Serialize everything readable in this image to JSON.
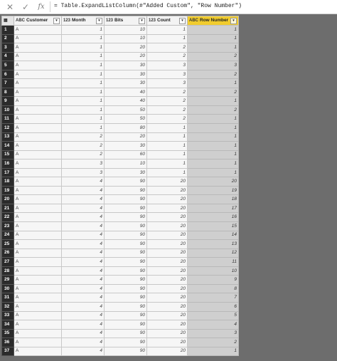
{
  "formula": {
    "text": "= Table.ExpandListColumn(#\"Added Custom\", \"Row Number\")",
    "cancel_icon": "close-icon",
    "commit_icon": "check-icon",
    "fx_label": "fx"
  },
  "columns": [
    {
      "label": "Customer",
      "type": "ABC"
    },
    {
      "label": "Month",
      "type": "123"
    },
    {
      "label": "Bits",
      "type": "123"
    },
    {
      "label": "Count",
      "type": "123"
    },
    {
      "label": "Row Number",
      "type": "ABC"
    }
  ],
  "rows": [
    [
      "1",
      "A",
      "1",
      "10",
      "1",
      "1"
    ],
    [
      "2",
      "A",
      "1",
      "10",
      "1",
      "1"
    ],
    [
      "3",
      "A",
      "1",
      "20",
      "2",
      "1"
    ],
    [
      "4",
      "A",
      "1",
      "20",
      "2",
      "2"
    ],
    [
      "5",
      "A",
      "1",
      "30",
      "3",
      "3"
    ],
    [
      "6",
      "A",
      "1",
      "30",
      "3",
      "2"
    ],
    [
      "7",
      "A",
      "1",
      "30",
      "3",
      "1"
    ],
    [
      "8",
      "A",
      "1",
      "40",
      "2",
      "2"
    ],
    [
      "9",
      "A",
      "1",
      "40",
      "2",
      "1"
    ],
    [
      "10",
      "A",
      "1",
      "50",
      "2",
      "2"
    ],
    [
      "11",
      "A",
      "1",
      "50",
      "2",
      "1"
    ],
    [
      "12",
      "A",
      "1",
      "80",
      "1",
      "1"
    ],
    [
      "13",
      "A",
      "2",
      "20",
      "1",
      "1"
    ],
    [
      "14",
      "A",
      "2",
      "30",
      "1",
      "1"
    ],
    [
      "15",
      "A",
      "2",
      "60",
      "1",
      "1"
    ],
    [
      "16",
      "A",
      "3",
      "10",
      "1",
      "1"
    ],
    [
      "17",
      "A",
      "3",
      "30",
      "1",
      "1"
    ],
    [
      "18",
      "A",
      "4",
      "90",
      "20",
      "20"
    ],
    [
      "19",
      "A",
      "4",
      "90",
      "20",
      "19"
    ],
    [
      "20",
      "A",
      "4",
      "90",
      "20",
      "18"
    ],
    [
      "21",
      "A",
      "4",
      "90",
      "20",
      "17"
    ],
    [
      "22",
      "A",
      "4",
      "90",
      "20",
      "16"
    ],
    [
      "23",
      "A",
      "4",
      "90",
      "20",
      "15"
    ],
    [
      "24",
      "A",
      "4",
      "90",
      "20",
      "14"
    ],
    [
      "25",
      "A",
      "4",
      "90",
      "20",
      "13"
    ],
    [
      "26",
      "A",
      "4",
      "90",
      "20",
      "12"
    ],
    [
      "27",
      "A",
      "4",
      "90",
      "20",
      "11"
    ],
    [
      "28",
      "A",
      "4",
      "90",
      "20",
      "10"
    ],
    [
      "29",
      "A",
      "4",
      "90",
      "20",
      "9"
    ],
    [
      "30",
      "A",
      "4",
      "90",
      "20",
      "8"
    ],
    [
      "31",
      "A",
      "4",
      "90",
      "20",
      "7"
    ],
    [
      "32",
      "A",
      "4",
      "90",
      "20",
      "6"
    ],
    [
      "33",
      "A",
      "4",
      "90",
      "20",
      "5"
    ],
    [
      "34",
      "A",
      "4",
      "90",
      "20",
      "4"
    ],
    [
      "35",
      "A",
      "4",
      "90",
      "20",
      "3"
    ],
    [
      "36",
      "A",
      "4",
      "90",
      "20",
      "2"
    ],
    [
      "37",
      "A",
      "4",
      "90",
      "20",
      "1"
    ]
  ],
  "colors": {
    "selected_header": "#f1cc2e",
    "selected_column": "#cfcfcf",
    "index_column": "#2b2b2b",
    "background": "#6d6d6d"
  }
}
